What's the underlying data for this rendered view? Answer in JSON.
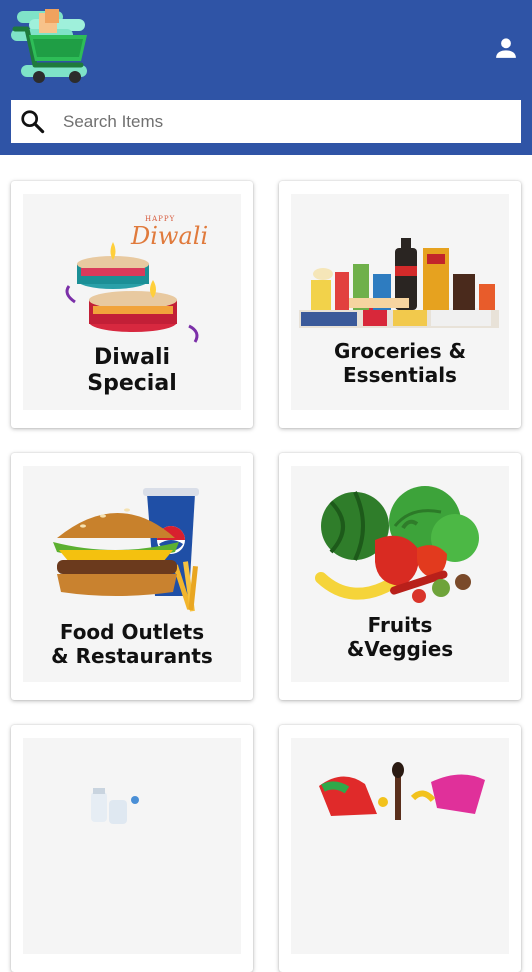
{
  "app": {
    "logo_icon": "shopping-cart-logo",
    "account_icon": "person-icon",
    "header_color": "#2f54a6"
  },
  "search": {
    "placeholder": "Search Items",
    "icon": "search-icon"
  },
  "categories": [
    {
      "title": "Diwali\nSpecial",
      "badge": "HAPPY",
      "badge_script": "Diwali"
    },
    {
      "title": "Groceries &\nEssentials"
    },
    {
      "title": "Food Outlets\n& Restaurants"
    },
    {
      "title": "Fruits\n&Veggies"
    },
    {
      "title": ""
    },
    {
      "title": ""
    }
  ]
}
